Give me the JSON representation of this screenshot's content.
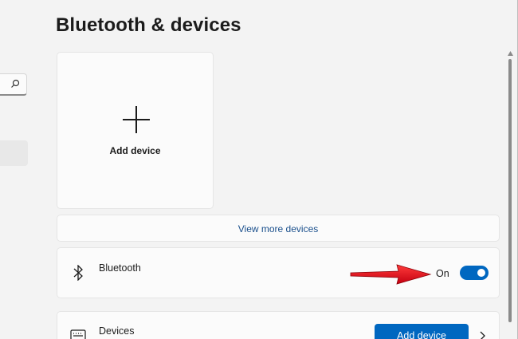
{
  "page": {
    "title": "Bluetooth & devices"
  },
  "add_card": {
    "label": "Add device",
    "icon": "plus-icon"
  },
  "view_more": {
    "label": "View more devices"
  },
  "bluetooth": {
    "label": "Bluetooth",
    "state": "On",
    "toggle_on": true,
    "icon": "bluetooth-icon"
  },
  "devices": {
    "label": "Devices",
    "button_label": "Add device",
    "icon": "keyboard-icon"
  },
  "colors": {
    "accent": "#0067c0",
    "link": "#1a4f8c",
    "annotation_arrow": "#e8141b",
    "background": "#f3f3f3",
    "card": "#fbfbfb"
  }
}
